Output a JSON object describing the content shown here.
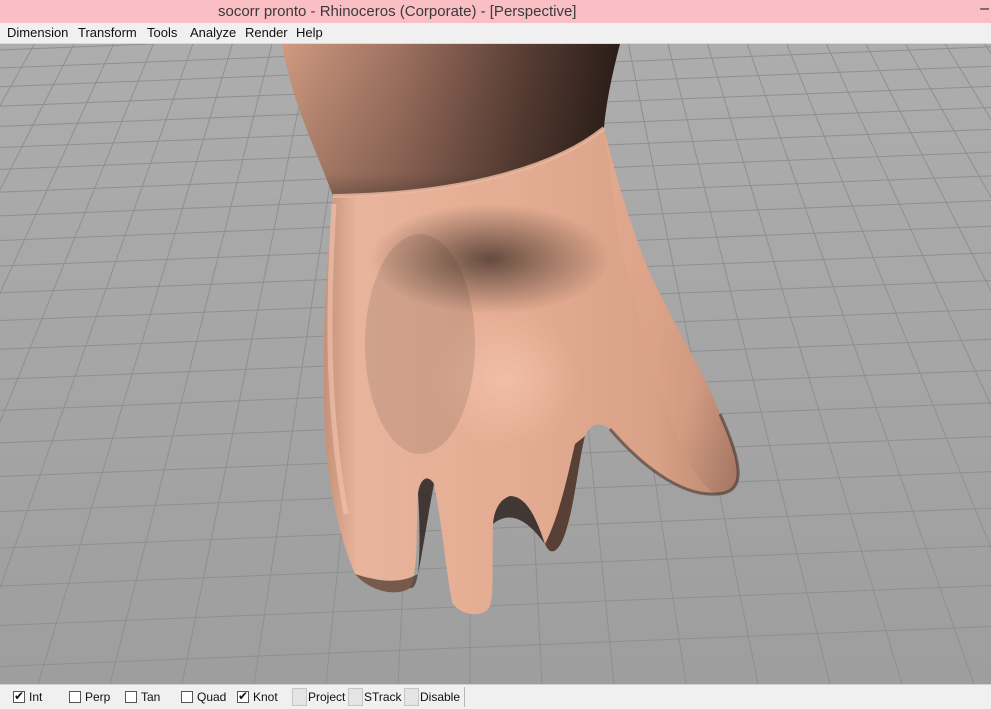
{
  "window": {
    "title": "socorr pronto - Rhinoceros (Corporate) - [Perspective]",
    "title_glyph": "–"
  },
  "menu": {
    "items": [
      "Dimension",
      "Transform",
      "Tools",
      "Analyze",
      "Render",
      "Help"
    ]
  },
  "viewport": {
    "name": "Perspective",
    "model": "hand-shaped surface",
    "colors": {
      "background": "#a3a3a3",
      "grid_line": "#8f8f8f",
      "surface": "#e0a68c",
      "surface_shadow": "#3b2a22"
    }
  },
  "statusbar": {
    "osnaps": [
      {
        "label": "Int",
        "checked": true
      },
      {
        "label": "Perp",
        "checked": false
      },
      {
        "label": "Tan",
        "checked": false
      },
      {
        "label": "Quad",
        "checked": false
      },
      {
        "label": "Knot",
        "checked": true
      }
    ],
    "toggles": [
      "Project",
      "STrack",
      "Disable"
    ]
  }
}
